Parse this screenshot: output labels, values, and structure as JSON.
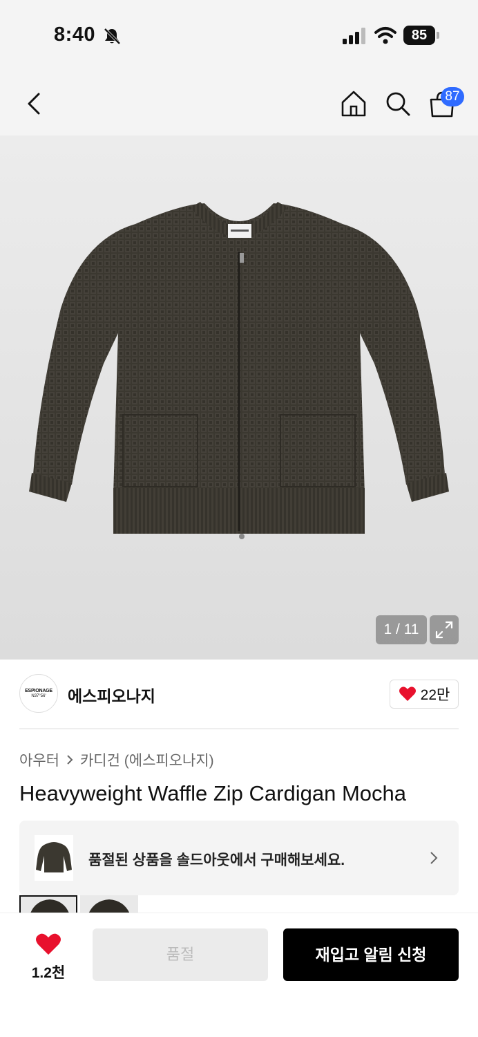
{
  "status_bar": {
    "time": "8:40",
    "battery": "85"
  },
  "header": {
    "cart_count": "87"
  },
  "gallery": {
    "counter": "1 / 11"
  },
  "brand": {
    "logo_text": "ESPIONAGE",
    "logo_sub": "N37°56'",
    "name": "에스피오나지",
    "likes": "22만"
  },
  "breadcrumb": [
    "아우터",
    "카디건 (에스피오나지)"
  ],
  "product": {
    "title": "Heavyweight Waffle Zip Cardigan Mocha"
  },
  "promo": {
    "text": "품절된 상품을 솔드아웃에서 구매해보세요."
  },
  "actions": {
    "wish_count": "1.2천",
    "soldout_label": "품절",
    "restock_label": "재입고 알림 신청"
  },
  "colors": {
    "accent_blue": "#2f6bff",
    "heart_red": "#e8112d",
    "garment": "#3b3830"
  },
  "icons": [
    "bell-off-icon",
    "signal-icon",
    "wifi-icon",
    "back-arrow-icon",
    "home-icon",
    "search-icon",
    "cart-icon",
    "expand-icon",
    "heart-icon",
    "chevron-right-icon"
  ]
}
